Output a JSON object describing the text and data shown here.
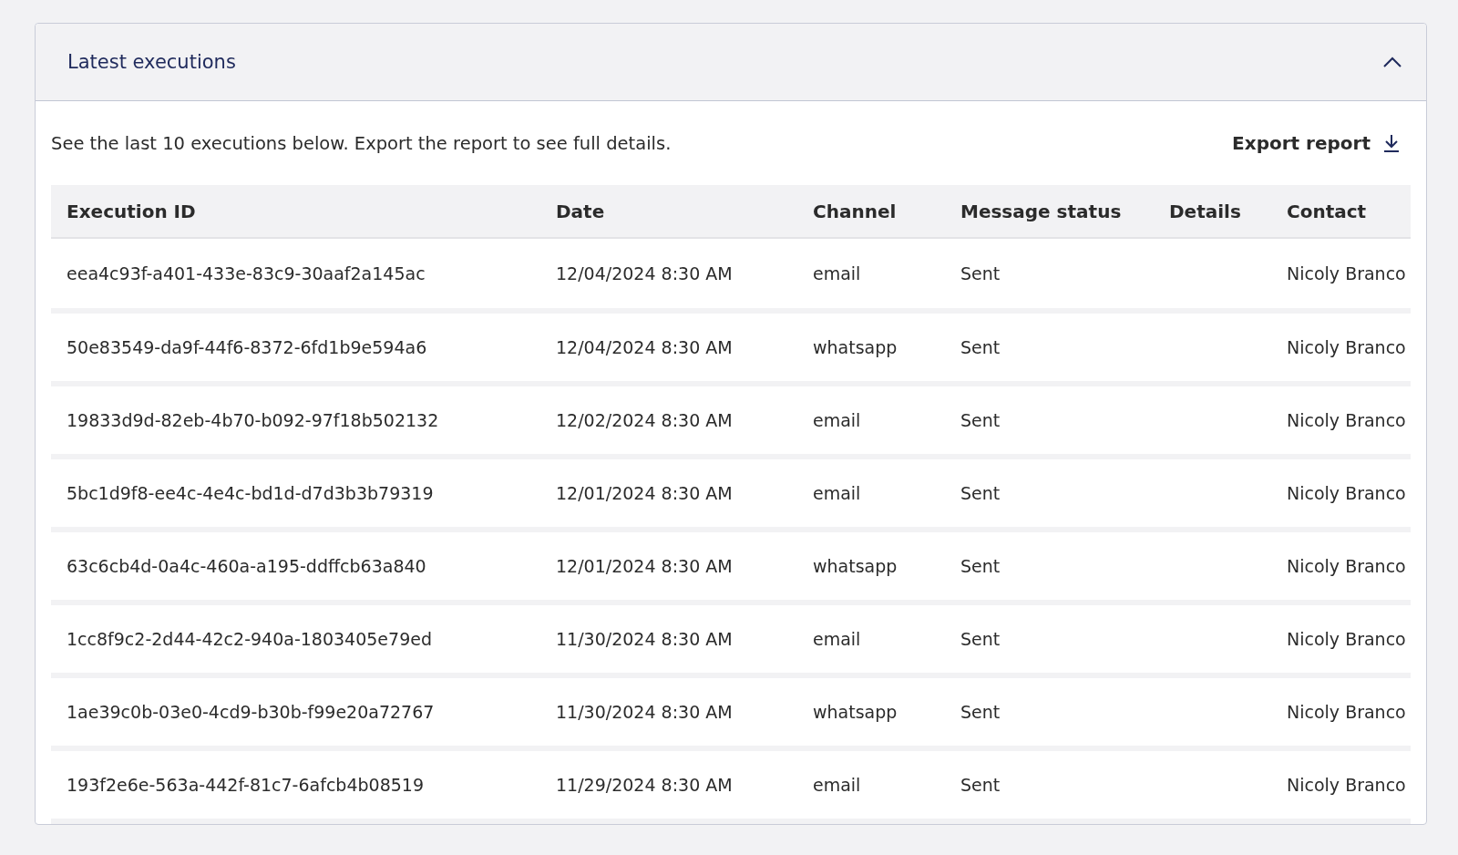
{
  "panel": {
    "title": "Latest executions",
    "expanded": true
  },
  "description": "See the last 10 executions below. Export the report to see full details.",
  "export_button": {
    "label": "Export report"
  },
  "table": {
    "columns": [
      "Execution ID",
      "Date",
      "Channel",
      "Message status",
      "Details",
      "Contact"
    ],
    "rows": [
      [
        "eea4c93f-a401-433e-83c9-30aaf2a145ac",
        "12/04/2024 8:30 AM",
        "email",
        "Sent",
        "",
        "Nicoly Branco"
      ],
      [
        "50e83549-da9f-44f6-8372-6fd1b9e594a6",
        "12/04/2024 8:30 AM",
        "whatsapp",
        "Sent",
        "",
        "Nicoly Branco"
      ],
      [
        "19833d9d-82eb-4b70-b092-97f18b502132",
        "12/02/2024 8:30 AM",
        "email",
        "Sent",
        "",
        "Nicoly Branco"
      ],
      [
        "5bc1d9f8-ee4c-4e4c-bd1d-d7d3b3b79319",
        "12/01/2024 8:30 AM",
        "email",
        "Sent",
        "",
        "Nicoly Branco"
      ],
      [
        "63c6cb4d-0a4c-460a-a195-ddffcb63a840",
        "12/01/2024 8:30 AM",
        "whatsapp",
        "Sent",
        "",
        "Nicoly Branco"
      ],
      [
        "1cc8f9c2-2d44-42c2-940a-1803405e79ed",
        "11/30/2024 8:30 AM",
        "email",
        "Sent",
        "",
        "Nicoly Branco"
      ],
      [
        "1ae39c0b-03e0-4cd9-b30b-f99e20a72767",
        "11/30/2024 8:30 AM",
        "whatsapp",
        "Sent",
        "",
        "Nicoly Branco"
      ],
      [
        "193f2e6e-563a-442f-81c7-6afcb4b08519",
        "11/29/2024 8:30 AM",
        "email",
        "Sent",
        "",
        "Nicoly Branco"
      ]
    ]
  }
}
